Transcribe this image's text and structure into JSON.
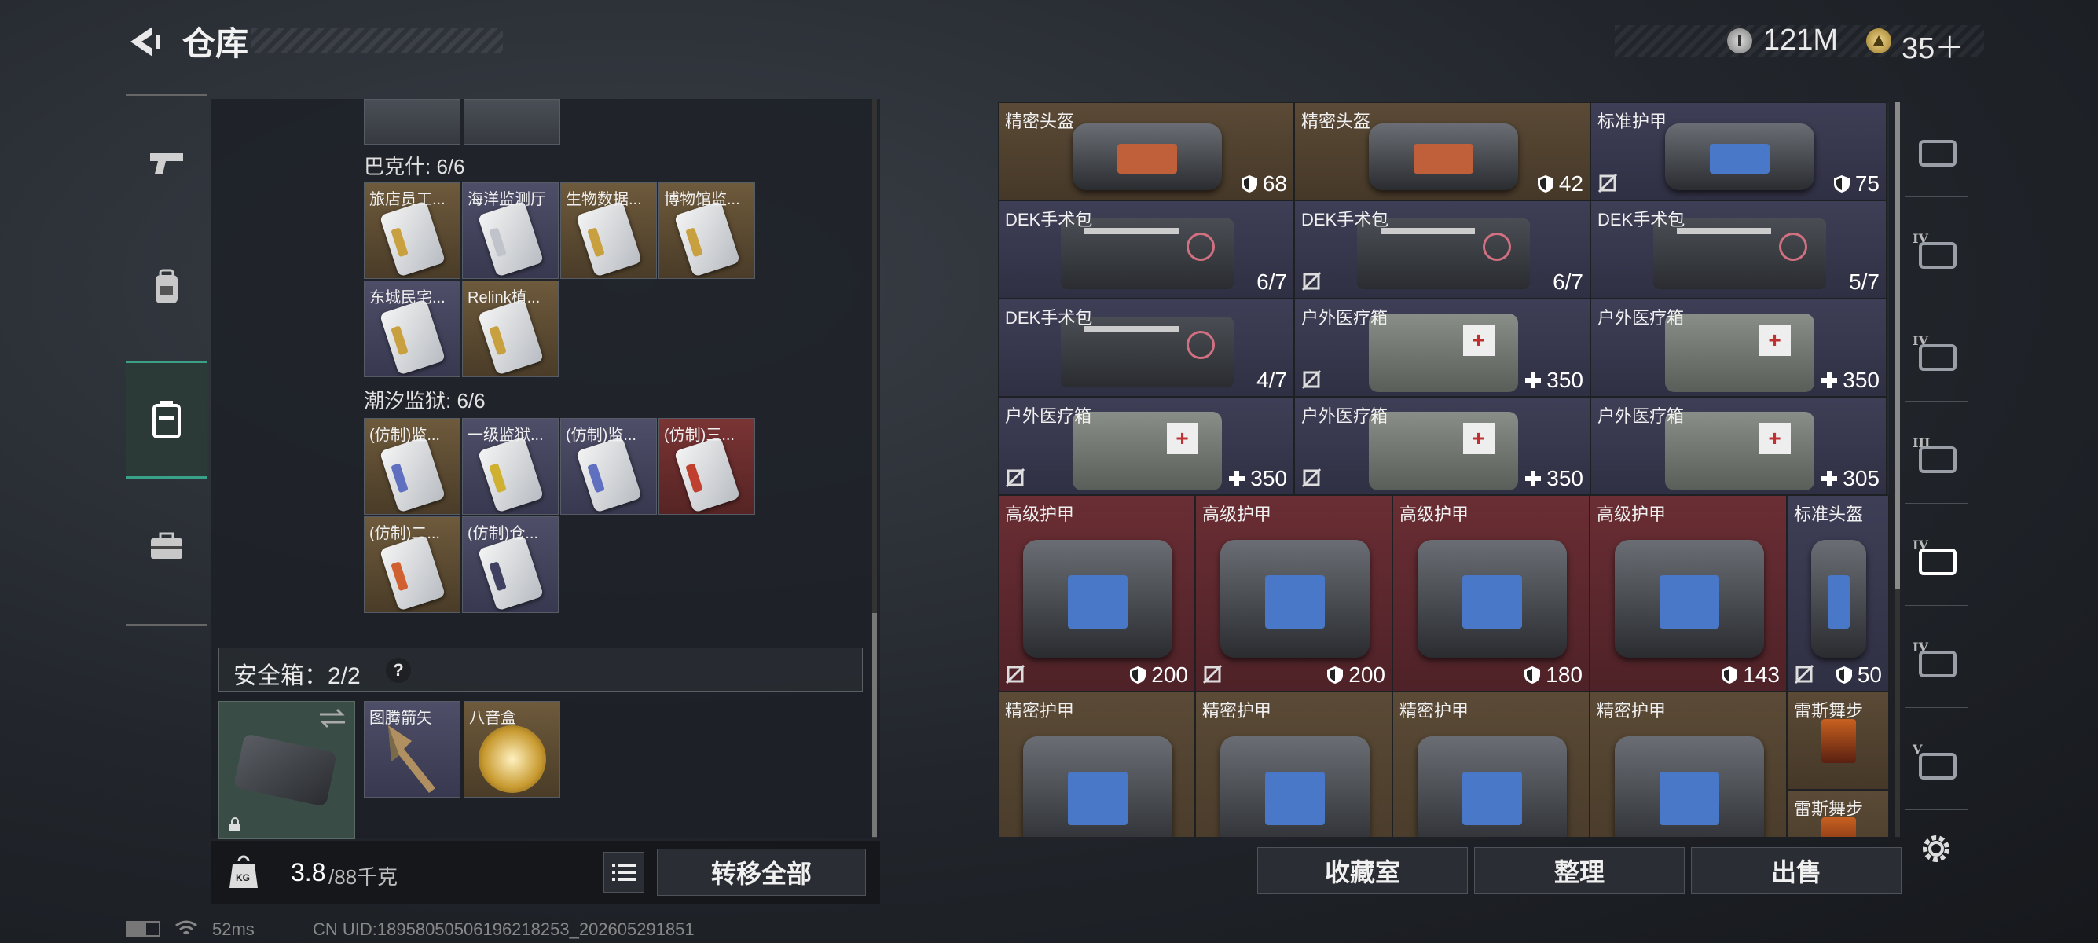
{
  "header": {
    "title": "仓库",
    "currency1": "121M",
    "currency2": "35＋"
  },
  "left_nav": [
    {
      "name": "weapon",
      "icon": "gun-icon"
    },
    {
      "name": "equipment",
      "icon": "backpack-icon"
    },
    {
      "name": "container",
      "icon": "case-icon",
      "active": true
    },
    {
      "name": "tools",
      "icon": "toolbox-icon"
    }
  ],
  "groups": [
    {
      "label": "巴克什: 6/6",
      "items": [
        {
          "name": "旅店员工...",
          "rarity": "gold",
          "strip": "#c8a040"
        },
        {
          "name": "海洋监测厅",
          "rarity": "purple",
          "strip": "#c0c4ca"
        },
        {
          "name": "生物数据...",
          "rarity": "gold",
          "strip": "#c8a040"
        },
        {
          "name": "博物馆监...",
          "rarity": "gold",
          "strip": "#c8a040"
        },
        {
          "name": "东城民宅...",
          "rarity": "purple",
          "strip": "#c8a040"
        },
        {
          "name": "Relink植...",
          "rarity": "gold",
          "strip": "#c8a040"
        }
      ]
    },
    {
      "label": "潮汐监狱: 6/6",
      "items": [
        {
          "name": "(仿制)监...",
          "rarity": "gold",
          "strip": "#6070c0"
        },
        {
          "name": "一级监狱...",
          "rarity": "purple",
          "strip": "#d0b030"
        },
        {
          "name": "(仿制)监...",
          "rarity": "purple",
          "strip": "#6070c0"
        },
        {
          "name": "(仿制)三...",
          "rarity": "red",
          "strip": "#c04030"
        },
        {
          "name": "(仿制)二...",
          "rarity": "gold",
          "strip": "#d06030"
        },
        {
          "name": "(仿制)仓...",
          "rarity": "purple",
          "strip": "#404060"
        }
      ]
    }
  ],
  "safe_box": {
    "label": "安全箱：2/2",
    "help": "?",
    "items": [
      {
        "name": "图腾箭矢",
        "rarity": "purple"
      },
      {
        "name": "八音盒",
        "rarity": "gold"
      }
    ]
  },
  "footer_left": {
    "weight_current": "3.8",
    "weight_max": "/88千克",
    "kg_badge": "KG",
    "transfer_all": "转移全部"
  },
  "grid_items": [
    {
      "name": "精密头盔",
      "value": "68",
      "kind": "shield",
      "rarity": "brown"
    },
    {
      "name": "精密头盔",
      "value": "42",
      "kind": "shield",
      "rarity": "brown"
    },
    {
      "name": "标准护甲",
      "value": "75",
      "kind": "shield",
      "rarity": "purple",
      "noshare": true
    },
    {
      "name": "DEK手术包",
      "value": "6/7",
      "kind": "count",
      "rarity": "purple"
    },
    {
      "name": "DEK手术包",
      "value": "6/7",
      "kind": "count",
      "rarity": "purple",
      "noshare": true
    },
    {
      "name": "DEK手术包",
      "value": "5/7",
      "kind": "count",
      "rarity": "purple"
    },
    {
      "name": "DEK手术包",
      "value": "4/7",
      "kind": "count",
      "rarity": "purple"
    },
    {
      "name": "户外医疗箱",
      "value": "350",
      "kind": "heal",
      "rarity": "purple",
      "noshare": true
    },
    {
      "name": "户外医疗箱",
      "value": "350",
      "kind": "heal",
      "rarity": "purple"
    },
    {
      "name": "户外医疗箱",
      "value": "350",
      "kind": "heal",
      "rarity": "purple",
      "noshare": true
    },
    {
      "name": "户外医疗箱",
      "value": "350",
      "kind": "heal",
      "rarity": "purple",
      "noshare": true
    },
    {
      "name": "户外医疗箱",
      "value": "305",
      "kind": "heal",
      "rarity": "purple"
    },
    {
      "name": "高级护甲",
      "value": "200",
      "kind": "shield",
      "rarity": "red",
      "noshare": true
    },
    {
      "name": "高级护甲",
      "value": "200",
      "kind": "shield",
      "rarity": "red",
      "noshare": true
    },
    {
      "name": "高级护甲",
      "value": "180",
      "kind": "shield",
      "rarity": "red"
    },
    {
      "name": "高级护甲",
      "value": "143",
      "kind": "shield",
      "rarity": "red"
    },
    {
      "name": "标准头盔",
      "value": "50",
      "kind": "shield",
      "rarity": "purple",
      "noshare": true
    },
    {
      "name": "精密护甲",
      "value": "",
      "kind": "shield",
      "rarity": "brown"
    },
    {
      "name": "精密护甲",
      "value": "",
      "kind": "shield",
      "rarity": "brown"
    },
    {
      "name": "精密护甲",
      "value": "",
      "kind": "shield",
      "rarity": "brown"
    },
    {
      "name": "精密护甲",
      "value": "",
      "kind": "shield",
      "rarity": "brown"
    },
    {
      "name": "雷斯舞步",
      "value": "",
      "kind": "none",
      "rarity": "brown"
    },
    {
      "name": "雷斯舞步",
      "value": "",
      "kind": "none",
      "rarity": "brown"
    }
  ],
  "right_nav": [
    {
      "icon": "backpack-slot-icon",
      "tier": ""
    },
    {
      "icon": "armor-slot-icon",
      "tier": "IV"
    },
    {
      "icon": "helmet-slot-icon",
      "tier": "IV"
    },
    {
      "icon": "helmet-slot-icon",
      "tier": "III"
    },
    {
      "icon": "medkit-slot-icon",
      "tier": "IV"
    },
    {
      "icon": "chest-rig-slot-icon",
      "tier": "IV"
    },
    {
      "icon": "chest-rig-slot-icon",
      "tier": "V"
    }
  ],
  "footer_right": {
    "collection_room": "收藏室",
    "organize": "整理",
    "sell": "出售"
  },
  "status": {
    "ping": "52ms",
    "uid": "CN UID:18958050506196218253_202605291851"
  }
}
